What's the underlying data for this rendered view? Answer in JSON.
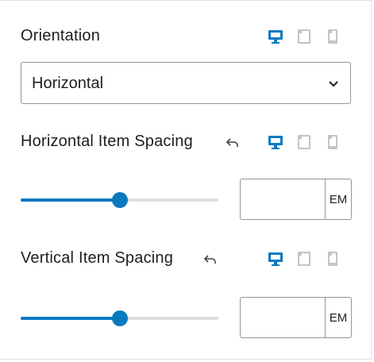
{
  "colors": {
    "accent": "#0a7abf",
    "inactive_device": "#bdbdbd"
  },
  "icons": {
    "devices": [
      "desktop-icon",
      "tablet-icon",
      "mobile-icon"
    ],
    "reset": "undo-arrow-icon",
    "chevron": "chevron-down-icon"
  },
  "orientation": {
    "label": "Orientation",
    "selected": "Horizontal",
    "active_device": "desktop"
  },
  "horizontal_spacing": {
    "label": "Horizontal Item Spacing",
    "slider_fraction": 0.5,
    "value": "",
    "unit": "EM",
    "active_device": "desktop"
  },
  "vertical_spacing": {
    "label": "Vertical Item Spacing",
    "slider_fraction": 0.5,
    "value": "",
    "unit": "EM",
    "active_device": "desktop"
  }
}
